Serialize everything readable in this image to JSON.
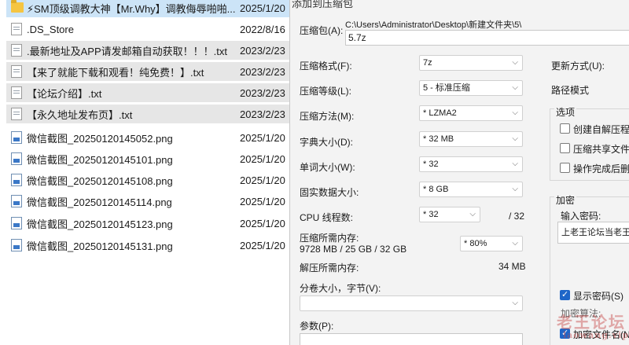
{
  "files": [
    {
      "name": "⚡SM顶级调教大神【Mr.Why】调教侮辱啪啪...",
      "date": "2025/1/20",
      "icon": "folder-icon"
    },
    {
      "name": ".DS_Store",
      "date": "2022/8/16",
      "icon": "document-icon"
    },
    {
      "name": ".最新地址及APP请发邮箱自动获取！！！.txt",
      "date": "2023/2/23",
      "icon": "document-icon"
    },
    {
      "name": "【来了就能下载和观看！纯免费！】.txt",
      "date": "2023/2/23",
      "icon": "document-icon"
    },
    {
      "name": "【论坛介绍】.txt",
      "date": "2023/2/23",
      "icon": "document-icon"
    },
    {
      "name": "【永久地址发布页】.txt",
      "date": "2023/2/23",
      "icon": "document-icon"
    },
    {
      "name": "微信截图_20250120145052.png",
      "date": "2025/1/20",
      "icon": "image-icon"
    },
    {
      "name": "微信截图_20250120145101.png",
      "date": "2025/1/20",
      "icon": "image-icon"
    },
    {
      "name": "微信截图_20250120145108.png",
      "date": "2025/1/20",
      "icon": "image-icon"
    },
    {
      "name": "微信截图_20250120145114.png",
      "date": "2025/1/20",
      "icon": "image-icon"
    },
    {
      "name": "微信截图_20250120145123.png",
      "date": "2025/1/20",
      "icon": "image-icon"
    },
    {
      "name": "微信截图_20250120145131.png",
      "date": "2025/1/20",
      "icon": "image-icon"
    }
  ],
  "dialog": {
    "title": "添加到压缩包",
    "archive_label": "压缩包(A):",
    "archive_path": "C:\\Users\\Administrator\\Desktop\\新建文件夹\\5\\",
    "archive_name": "5.7z",
    "format_label": "压缩格式(F):",
    "format_value": "7z",
    "level_label": "压缩等级(L):",
    "level_value": "5 - 标准压缩",
    "method_label": "压缩方法(M):",
    "method_value": "*  LZMA2",
    "dict_label": "字典大小(D):",
    "dict_value": "*  32 MB",
    "word_label": "单词大小(W):",
    "word_value": "*  32",
    "solid_label": "固实数据大小:",
    "solid_value": "*  8 GB",
    "threads_label": "CPU 线程数:",
    "threads_value": "*  32",
    "threads_max": "/ 32",
    "mem_label": "压缩所需内存:",
    "mem_value": "9728 MB / 25 GB / 32 GB",
    "mem_percent": "*  80%",
    "decomp_label": "解压所需内存:",
    "decomp_value": "34 MB",
    "split_label": "分卷大小，字节(V):",
    "split_value": "",
    "params_label": "参数(P):",
    "update_label": "更新方式(U):",
    "path_mode_label": "路径模式",
    "options_label": "选项",
    "opt_sfx": "创建自解压程序",
    "opt_shared": "压缩共享文件",
    "opt_delete": "操作完成后删除",
    "encrypt_label": "加密",
    "password_label": "输入密码:",
    "password_value": "上老王论坛当老王",
    "show_password": "显示密码(S)",
    "enc_method_label": "加密算法:",
    "enc_names": "加密文件名(N)"
  },
  "watermark": {
    "line1": "老王论坛",
    "line2": "laowang.vip"
  }
}
